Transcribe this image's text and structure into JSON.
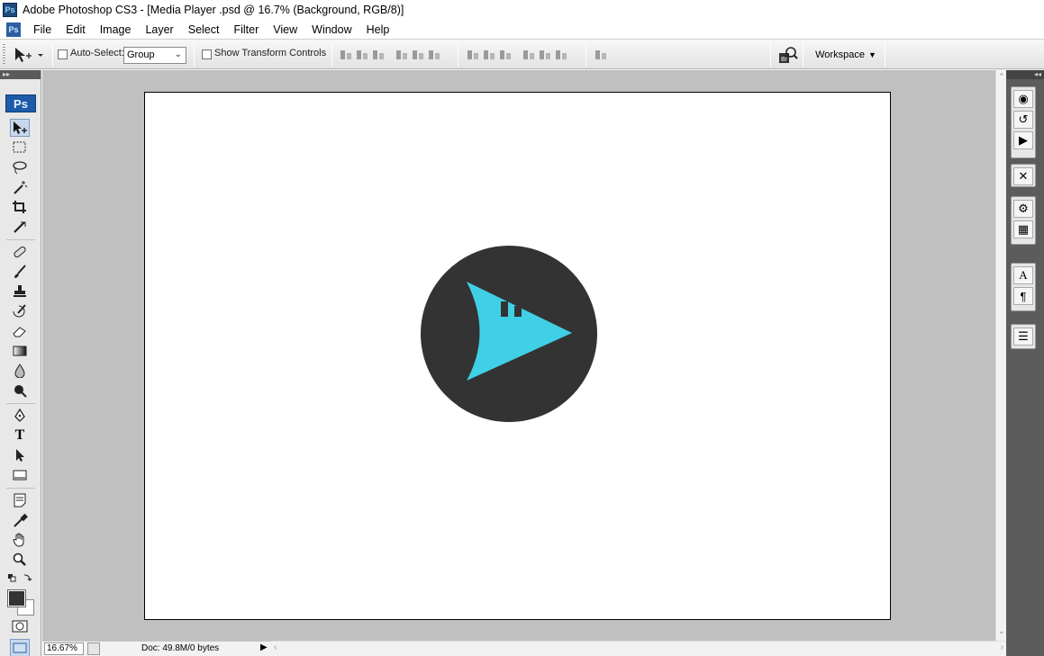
{
  "window": {
    "title": "Adobe Photoshop CS3 - [Media Player .psd @ 16.7% (Background, RGB/8)]",
    "app_badge": "Ps"
  },
  "menu": [
    "File",
    "Edit",
    "Image",
    "Layer",
    "Select",
    "Filter",
    "View",
    "Window",
    "Help"
  ],
  "options": {
    "auto_select_label": "Auto-Select:",
    "auto_select_value": "Group",
    "transform_label": "Show Transform Controls",
    "workspace_label": "Workspace"
  },
  "tools_panel": {
    "logo": "Ps"
  },
  "status": {
    "zoom": "16.67%",
    "doc_info": "Doc: 49.8M/0 bytes"
  },
  "artwork": {
    "circle_color": "#333333",
    "play_color": "#40d0e6"
  },
  "colors": {
    "foreground": "#333333",
    "background": "#ffffff"
  }
}
